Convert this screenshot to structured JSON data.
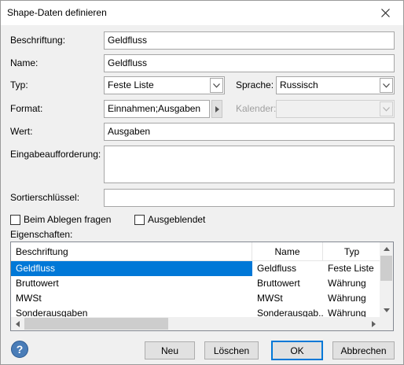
{
  "window": {
    "title": "Shape-Daten definieren"
  },
  "labels": {
    "beschriftung": "Beschriftung:",
    "name": "Name:",
    "typ": "Typ:",
    "sprache": "Sprache:",
    "format": "Format:",
    "kalender": "Kalender:",
    "wert": "Wert:",
    "eingabeaufforderung": "Eingabeaufforderung:",
    "sortierschluessel": "Sortierschlüssel:",
    "eigenschaften": "Eigenschaften:"
  },
  "fields": {
    "beschriftung": "Geldfluss",
    "name": "Geldfluss",
    "typ": "Feste Liste",
    "sprache": "Russisch",
    "format": "Einnahmen;Ausgaben",
    "kalender": "",
    "wert": "Ausgaben",
    "eingabeaufforderung": "",
    "sortierschluessel": ""
  },
  "checkboxes": {
    "beim_ablegen": {
      "label": "Beim Ablegen fragen",
      "checked": false
    },
    "ausgeblendet": {
      "label": "Ausgeblendet",
      "checked": false
    }
  },
  "table": {
    "columns": [
      "Beschriftung",
      "Name",
      "Typ"
    ],
    "rows": [
      [
        "Geldfluss",
        "Geldfluss",
        "Feste Liste"
      ],
      [
        "Bruttowert",
        "Bruttowert",
        "Währung"
      ],
      [
        "MWSt",
        "MWSt",
        "Währung"
      ],
      [
        "Sonderausgaben",
        "Sonderausgab...",
        "Währung"
      ]
    ],
    "selected_row": 0
  },
  "buttons": {
    "neu": "Neu",
    "loeschen": "Löschen",
    "ok": "OK",
    "abbrechen": "Abbrechen"
  },
  "colors": {
    "selection": "#0078d7",
    "default_button_border": "#0078d7"
  }
}
